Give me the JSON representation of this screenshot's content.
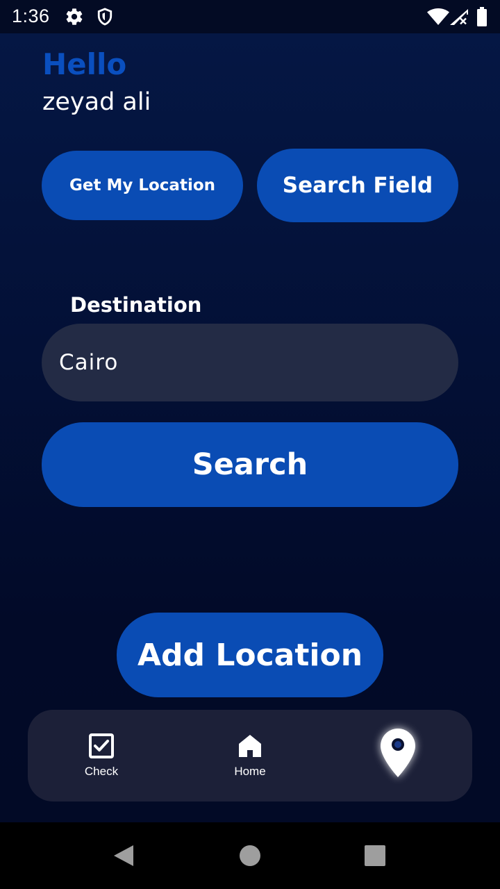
{
  "status_bar": {
    "time": "1:36",
    "icons": [
      "gear-icon",
      "shield-icon",
      "wifi-icon",
      "signal-icon",
      "battery-icon"
    ]
  },
  "greeting": {
    "title": "Hello",
    "username": "zeyad ali"
  },
  "actions": {
    "get_location_label": "Get My Location",
    "search_field_label": "Search Field"
  },
  "destination": {
    "label": "Destination",
    "value": "Cairo",
    "placeholder": ""
  },
  "search_button_label": "Search",
  "add_location_label": "Add Location",
  "bottom_nav": {
    "items": [
      {
        "label": "Check",
        "icon": "check-square-icon"
      },
      {
        "label": "Home",
        "icon": "home-icon"
      },
      {
        "label": "",
        "icon": "location-pin-icon",
        "selected": true
      }
    ]
  },
  "system_nav": {
    "icons": [
      "back-icon",
      "home-circle-icon",
      "recents-icon"
    ]
  },
  "colors": {
    "accent": "#0a4cb4",
    "greeting": "#0a4fbf",
    "background": "#031036",
    "input_bg": "#232b45",
    "nav_bg": "#1c2038"
  }
}
